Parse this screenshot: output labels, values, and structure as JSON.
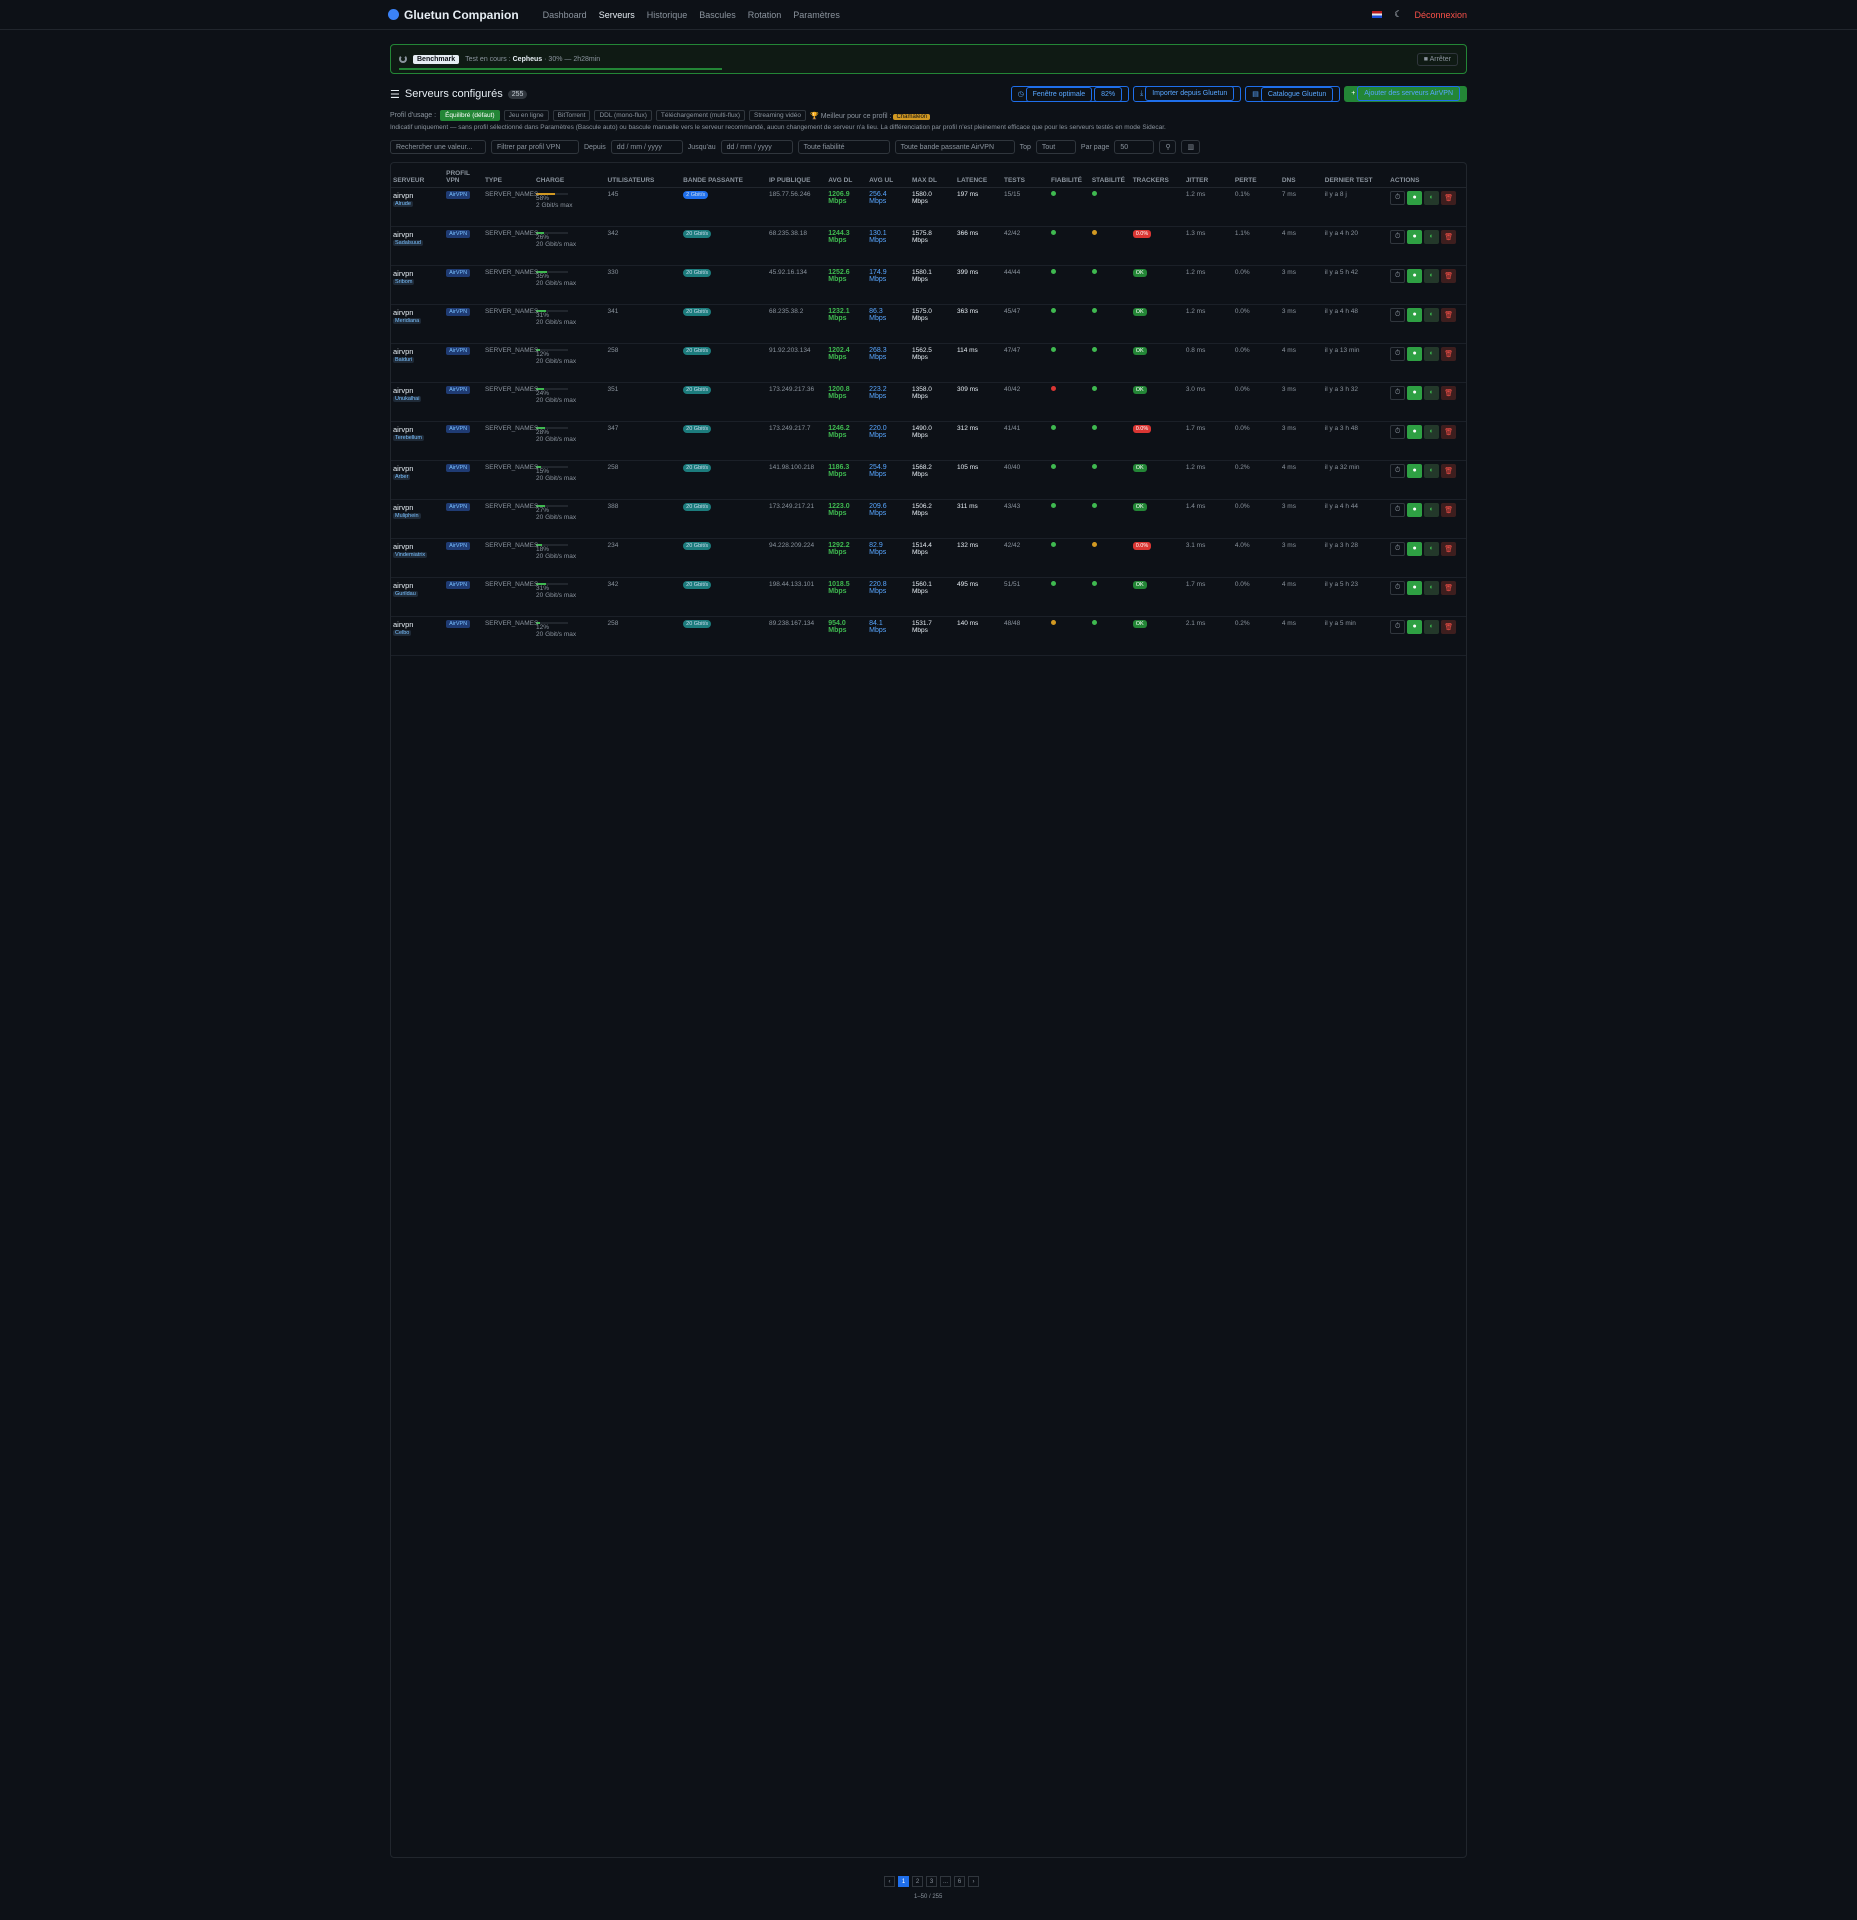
{
  "app": {
    "title": "Gluetun Companion",
    "logout": "Déconnexion"
  },
  "nav": [
    "Dashboard",
    "Serveurs",
    "Historique",
    "Bascules",
    "Rotation",
    "Paramètres"
  ],
  "benchmark": {
    "tag": "Benchmark",
    "label": "Test en cours :",
    "server": "Cepheus",
    "progress": "30% — 2h28min",
    "stop": "Arrêter",
    "progress_fraction": 0.3
  },
  "section": {
    "title": "Serveurs configurés",
    "count": "255",
    "btn_window": "Fenêtre optimale",
    "btn_window_badge": "82%",
    "btn_import": "Importer depuis Gluetun",
    "btn_catalog": "Catalogue Gluetun",
    "btn_add": "Ajouter des serveurs AirVPN"
  },
  "profile": {
    "label": "Profil d'usage :",
    "options": [
      "Équilibré (défaut)",
      "Jeu en ligne",
      "BitTorrent",
      "DDL (mono-flux)",
      "Téléchargement (multi-flux)",
      "Streaming vidéo"
    ],
    "best_label": "Meilleur pour ce profil :",
    "best_server": "Chamaleon",
    "note": "Indicatif uniquement — sans profil sélectionné dans Paramètres (Bascule auto) ou bascule manuelle vers le serveur recommandé, aucun changement de serveur n'a lieu. La différenciation par profil n'est pleinement efficace que pour les serveurs testés en mode Sidecar."
  },
  "filters": {
    "search_placeholder": "Rechercher une valeur...",
    "profile": "Filtrer par profil VPN",
    "since": "Depuis",
    "until": "Jusqu'au",
    "date_placeholder": "dd / mm / yyyy",
    "reliability": "Toute fiabilité",
    "bandwidth": "Toute bande passante AirVPN",
    "top": "Top",
    "top_value": "Tout",
    "per_page": "Par page",
    "per_page_value": "50"
  },
  "columns": [
    "SERVEUR",
    "PROFIL VPN",
    "TYPE",
    "CHARGE",
    "UTILISATEURS",
    "BANDE PASSANTE",
    "IP PUBLIQUE",
    "AVG DL",
    "AVG UL",
    "MAX DL",
    "LATENCE",
    "TESTS",
    "FIABILITÉ",
    "STABILITÉ",
    "TRACKERS",
    "JITTER",
    "PERTE",
    "DNS",
    "DERNIER TEST",
    "ACTIONS"
  ],
  "rows": [
    {
      "name": "airvpn",
      "host": "Alrude",
      "load": "58%",
      "loadc": "#d29922",
      "cap": "2 Gbit/s max",
      "users": "145",
      "bw": "2 Gbit/s",
      "ip": "185.77.56.246",
      "dl": "1206.9",
      "ul": "256.4",
      "max": "1580.0",
      "lat": "197 ms",
      "tests": "15/15",
      "rel": "#3fb950",
      "stab": "#3fb950",
      "trk": "",
      "jit": "1.2 ms",
      "loss": "0.1%",
      "dns": "7 ms",
      "last": "il y a 8 j"
    },
    {
      "name": "airvpn",
      "host": "Sadalsuud",
      "load": "26%",
      "loadc": "#3fb950",
      "cap": "20 Gbit/s max",
      "users": "342",
      "bw": "20 Gbit/s",
      "ip": "68.235.38.18",
      "dl": "1244.3",
      "ul": "130.1",
      "max": "1575.8",
      "lat": "366 ms",
      "tests": "42/42",
      "rel": "#3fb950",
      "stab": "#d29922",
      "trk": "0.0%",
      "jit": "1.3 ms",
      "loss": "1.1%",
      "dns": "4 ms",
      "last": "il y a 4 h 20"
    },
    {
      "name": "airvpn",
      "host": "Sribom",
      "load": "35%",
      "loadc": "#3fb950",
      "cap": "20 Gbit/s max",
      "users": "330",
      "bw": "20 Gbit/s",
      "ip": "45.92.16.134",
      "dl": "1252.6",
      "ul": "174.9",
      "max": "1580.1",
      "lat": "399 ms",
      "tests": "44/44",
      "rel": "#3fb950",
      "stab": "#3fb950",
      "trk": "OK",
      "jit": "1.2 ms",
      "loss": "0.0%",
      "dns": "3 ms",
      "last": "il y a 5 h 42"
    },
    {
      "name": "airvpn",
      "host": "Meridiana",
      "load": "31%",
      "loadc": "#3fb950",
      "cap": "20 Gbit/s max",
      "users": "341",
      "bw": "20 Gbit/s",
      "ip": "68.235.38.2",
      "dl": "1232.1",
      "ul": "86.3",
      "max": "1575.0",
      "lat": "363 ms",
      "tests": "45/47",
      "rel": "#3fb950",
      "stab": "#3fb950",
      "trk": "OK",
      "jit": "1.2 ms",
      "loss": "0.0%",
      "dns": "3 ms",
      "last": "il y a 4 h 48"
    },
    {
      "name": "airvpn",
      "host": "Baiduri",
      "load": "12%",
      "loadc": "#3fb950",
      "cap": "20 Gbit/s max",
      "users": "258",
      "bw": "20 Gbit/s",
      "ip": "91.92.203.134",
      "dl": "1202.4",
      "ul": "268.3",
      "max": "1562.5",
      "lat": "114 ms",
      "tests": "47/47",
      "rel": "#3fb950",
      "stab": "#3fb950",
      "trk": "OK",
      "jit": "0.8 ms",
      "loss": "0.0%",
      "dns": "4 ms",
      "last": "il y a 13 min"
    },
    {
      "name": "airvpn",
      "host": "Unukalhai",
      "load": "24%",
      "loadc": "#3fb950",
      "cap": "20 Gbit/s max",
      "users": "351",
      "bw": "20 Gbit/s",
      "ip": "173.249.217.36",
      "dl": "1200.8",
      "ul": "223.2",
      "max": "1358.0",
      "lat": "309 ms",
      "tests": "40/42",
      "rel": "#da3633",
      "stab": "#3fb950",
      "trk": "OK",
      "jit": "3.0 ms",
      "loss": "0.0%",
      "dns": "3 ms",
      "last": "il y a 3 h 32"
    },
    {
      "name": "airvpn",
      "host": "Terebellum",
      "load": "28%",
      "loadc": "#3fb950",
      "cap": "20 Gbit/s max",
      "users": "347",
      "bw": "20 Gbit/s",
      "ip": "173.249.217.7",
      "dl": "1246.2",
      "ul": "220.0",
      "max": "1490.0",
      "lat": "312 ms",
      "tests": "41/41",
      "rel": "#3fb950",
      "stab": "#3fb950",
      "trk": "0.0%",
      "jit": "1.7 ms",
      "loss": "0.0%",
      "dns": "3 ms",
      "last": "il y a 3 h 48"
    },
    {
      "name": "airvpn",
      "host": "Arber",
      "load": "15%",
      "loadc": "#3fb950",
      "cap": "20 Gbit/s max",
      "users": "258",
      "bw": "20 Gbit/s",
      "ip": "141.98.100.218",
      "dl": "1186.3",
      "ul": "254.9",
      "max": "1568.2",
      "lat": "105 ms",
      "tests": "40/40",
      "rel": "#3fb950",
      "stab": "#3fb950",
      "trk": "OK",
      "jit": "1.2 ms",
      "loss": "0.2%",
      "dns": "4 ms",
      "last": "il y a 32 min"
    },
    {
      "name": "airvpn",
      "host": "Muliphein",
      "load": "27%",
      "loadc": "#3fb950",
      "cap": "20 Gbit/s max",
      "users": "388",
      "bw": "20 Gbit/s",
      "ip": "173.249.217.21",
      "dl": "1223.0",
      "ul": "209.6",
      "max": "1506.2",
      "lat": "311 ms",
      "tests": "43/43",
      "rel": "#3fb950",
      "stab": "#3fb950",
      "trk": "OK",
      "jit": "1.4 ms",
      "loss": "0.0%",
      "dns": "3 ms",
      "last": "il y a 4 h 44"
    },
    {
      "name": "airvpn",
      "host": "Vindemiatrix",
      "load": "18%",
      "loadc": "#3fb950",
      "cap": "20 Gbit/s max",
      "users": "234",
      "bw": "20 Gbit/s",
      "ip": "94.228.209.224",
      "dl": "1292.2",
      "ul": "82.9",
      "max": "1514.4",
      "lat": "132 ms",
      "tests": "42/42",
      "rel": "#3fb950",
      "stab": "#d29922",
      "trk": "0.0%",
      "jit": "3.1 ms",
      "loss": "4.0%",
      "dns": "3 ms",
      "last": "il y a 3 h 28"
    },
    {
      "name": "airvpn",
      "host": "Gurildau",
      "load": "31%",
      "loadc": "#3fb950",
      "cap": "20 Gbit/s max",
      "users": "342",
      "bw": "20 Gbit/s",
      "ip": "198.44.133.101",
      "dl": "1018.5",
      "ul": "220.8",
      "max": "1560.1",
      "lat": "495 ms",
      "tests": "51/51",
      "rel": "#3fb950",
      "stab": "#3fb950",
      "trk": "OK",
      "jit": "1.7 ms",
      "loss": "0.0%",
      "dns": "4 ms",
      "last": "il y a 5 h 23"
    },
    {
      "name": "airvpn",
      "host": "Celbo",
      "load": "12%",
      "loadc": "#3fb950",
      "cap": "20 Gbit/s max",
      "users": "258",
      "bw": "20 Gbit/s",
      "ip": "89.238.167.134",
      "dl": "954.0",
      "ul": "84.1",
      "max": "1531.7",
      "lat": "140 ms",
      "tests": "48/48",
      "rel": "#d29922",
      "stab": "#3fb950",
      "trk": "OK",
      "jit": "2.1 ms",
      "loss": "0.2%",
      "dns": "4 ms",
      "last": "il y a 5 min"
    }
  ],
  "pagination": {
    "pages": [
      "‹",
      "1",
      "2",
      "3",
      "...",
      "6",
      "›"
    ],
    "range": "1–50 / 255"
  }
}
